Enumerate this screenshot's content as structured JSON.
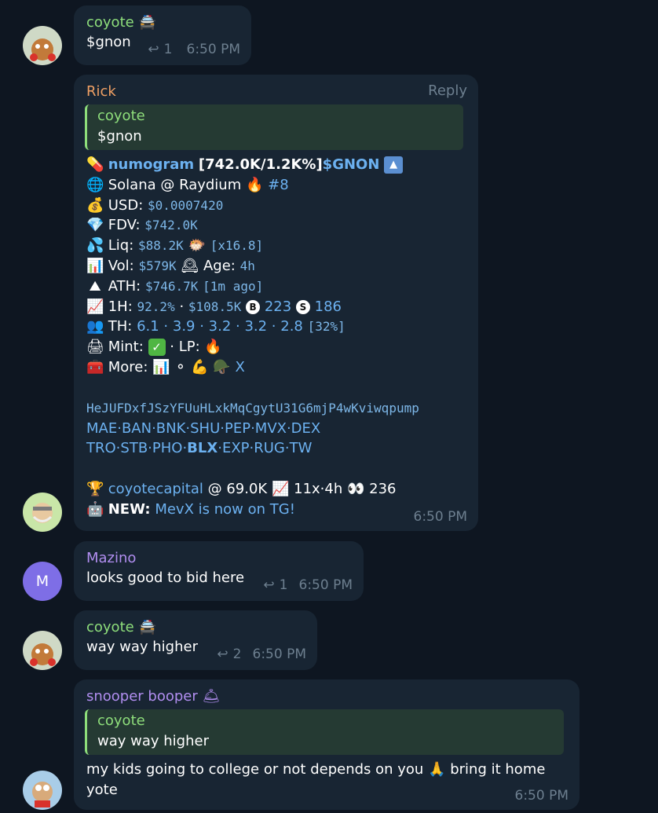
{
  "messages": [
    {
      "author": "coyote",
      "text": "$gnon",
      "reply_count": "1",
      "time": "6:50 PM"
    },
    {
      "author": "Rick",
      "reply_label": "Reply",
      "quote": {
        "author": "coyote",
        "text": "$gnon"
      },
      "bot": {
        "l1": {
          "name": "numogram",
          "stats": "[742.0K/1.2K%]",
          "ticker": "$GNON"
        },
        "l2": {
          "chain": "Solana @ Raydium",
          "rank": "#8"
        },
        "l3": {
          "label": "USD:",
          "value": "$0.0007420"
        },
        "l4": {
          "label": "FDV:",
          "value": "$742.0K"
        },
        "l5": {
          "label": "Liq:",
          "value": "$88.2K",
          "mult": "[x16.8]"
        },
        "l6": {
          "label": "Vol:",
          "value": "$579K",
          "age_label": "Age:",
          "age": "4h"
        },
        "l7": {
          "label": "ATH:",
          "value": "$746.7K",
          "ago": "[1m ago]"
        },
        "l8": {
          "label": "1H:",
          "pct": "92.2%",
          "sep": "·",
          "vol": "$108.5K",
          "buys": "223",
          "sells": "186",
          "b": "B",
          "s": "S"
        },
        "l9": {
          "label": "TH:",
          "values": "6.1 · 3.9 · 3.2 · 3.2 · 2.8",
          "total": "[32%]"
        },
        "l10": {
          "label": "Mint:",
          "mid": "· LP:",
          "check": "✓"
        },
        "l11": {
          "label": "More:",
          "x": "X"
        },
        "address": "HeJUFDxfJSzYFUuHLxkMqCgytU31G6mjP4wKviwqpump",
        "links1": "MAE·BAN·BNK·SHU·PEP·MVX·DEX",
        "links2_pre": "TRO·STB·PHO·",
        "links2_bold": "BLX",
        "links2_post": "·EXP·RUG·TW",
        "promo": {
          "name": "coyotecapital",
          "at": "@ 69.0K",
          "stats": "11x·4h",
          "views": "236"
        },
        "news": {
          "label": "NEW:",
          "text": "MevX is now on TG!"
        }
      },
      "time": "6:50 PM"
    },
    {
      "author": "Mazino",
      "avatar_letter": "M",
      "text": "looks good to bid here",
      "reply_count": "1",
      "time": "6:50 PM"
    },
    {
      "author": "coyote",
      "text": "way way higher",
      "reply_count": "2",
      "time": "6:50 PM"
    },
    {
      "author": "snooper booper",
      "quote": {
        "author": "coyote",
        "text": "way way higher"
      },
      "text1": "my kids going to college or not depends on you",
      "text2": "bring it home",
      "text3": "yote",
      "time": "6:50 PM"
    }
  ],
  "colors": {
    "bg": "#0e1621",
    "bubble": "#182533",
    "green": "#8ede7b",
    "orange": "#f0a064",
    "purple": "#b18ef0",
    "link": "#6cb1f0"
  },
  "icons": [
    "reply-arrow-icon",
    "pill-icon",
    "globe-icon",
    "fire-icon",
    "money-bag-icon",
    "gem-icon",
    "droplets-icon",
    "chart-icon",
    "clock-icon",
    "mountain-icon",
    "trend-up-icon",
    "users-icon",
    "printer-icon",
    "check-icon",
    "toolbox-icon",
    "trophy-icon",
    "robot-icon",
    "eyes-icon",
    "pray-icon",
    "cop-cap-icon"
  ]
}
